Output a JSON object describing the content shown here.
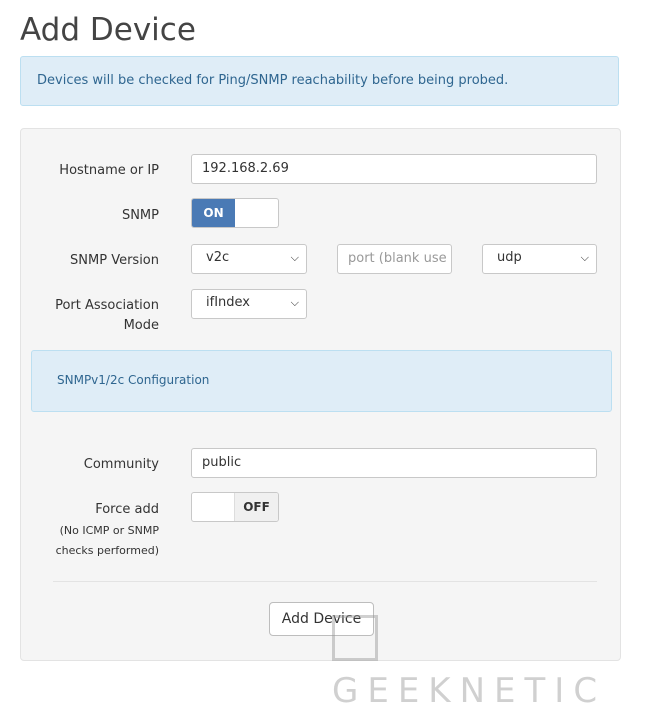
{
  "page": {
    "title": "Add Device"
  },
  "info_alert": "Devices will be checked for Ping/SNMP reachability before being probed.",
  "form": {
    "hostname_label": "Hostname or IP",
    "hostname_value": "192.168.2.69",
    "snmp_label": "SNMP",
    "snmp_toggle": {
      "state": "on",
      "on_label": "ON"
    },
    "snmp_version_label": "SNMP Version",
    "snmp_version_value": "v2c",
    "port_placeholder": "port (blank use",
    "transport_value": "udp",
    "port_assoc_label_line1": "Port Association",
    "port_assoc_label_line2": "Mode",
    "port_assoc_value": "ifIndex",
    "snmp_section_title": "SNMPv1/2c Configuration",
    "community_label": "Community",
    "community_value": "public",
    "force_add_label": "Force add",
    "force_add_note_line1": "(No ICMP or SNMP",
    "force_add_note_line2": "checks performed)",
    "force_add_toggle": {
      "state": "off",
      "off_label": "OFF"
    },
    "submit_label": "Add Device"
  },
  "watermark": {
    "text": "GEEKNETIC"
  },
  "icons": {
    "select_caret": "chevron-down-icon",
    "watermark_logo": "geeknetic-logo-icon"
  },
  "colors": {
    "toggle_on": "#4a7ab5",
    "info_bg": "#dfedf7",
    "info_text": "#2f6690"
  }
}
